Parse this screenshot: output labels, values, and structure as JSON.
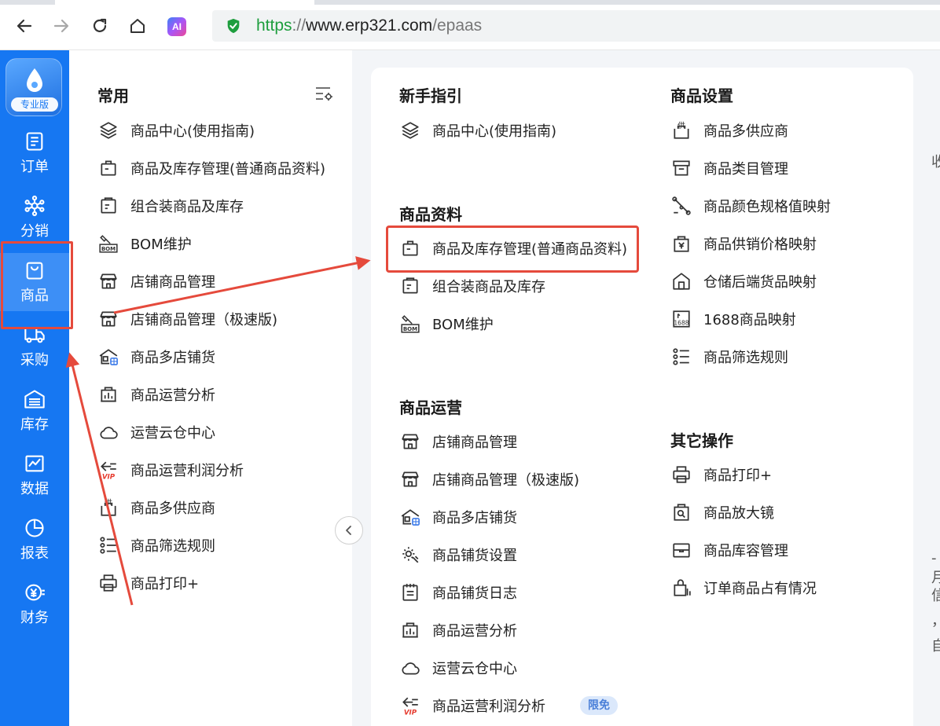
{
  "browser": {
    "url_scheme": "https",
    "url_sep": "://",
    "url_host": "www.erp321.com",
    "url_path": "/epaas",
    "ai_label": "AI"
  },
  "sidebar": {
    "logo_label": "专业版",
    "items": [
      {
        "label": "订单",
        "icon": "order-list-icon"
      },
      {
        "label": "分销",
        "icon": "distribution-network-icon"
      },
      {
        "label": "商品",
        "icon": "shopping-bag-icon"
      },
      {
        "label": "采购",
        "icon": "delivery-truck-icon"
      },
      {
        "label": "库存",
        "icon": "warehouse-icon"
      },
      {
        "label": "数据",
        "icon": "line-chart-icon"
      },
      {
        "label": "报表",
        "icon": "pie-chart-icon"
      },
      {
        "label": "财务",
        "icon": "yuan-coin-icon"
      }
    ]
  },
  "favorites": {
    "title": "常用",
    "items": [
      "商品中心(使用指南)",
      "商品及库存管理(普通商品资料)",
      "组合装商品及库存",
      "BOM维护",
      "店铺商品管理",
      "店铺商品管理（极速版)",
      "商品多店铺货",
      "商品运营分析",
      "运营云仓中心",
      "商品运营利润分析",
      "商品多供应商",
      "商品筛选规则",
      "商品打印+"
    ]
  },
  "menu": {
    "guide": {
      "title": "新手指引",
      "items": [
        "商品中心(使用指南)"
      ]
    },
    "data": {
      "title": "商品资料",
      "items": [
        "商品及库存管理(普通商品资料)",
        "组合装商品及库存",
        "BOM维护"
      ]
    },
    "ops": {
      "title": "商品运营",
      "items": [
        "店铺商品管理",
        "店铺商品管理（极速版)",
        "商品多店铺货",
        "商品铺货设置",
        "商品铺货日志",
        "商品运营分析",
        "运营云仓中心",
        "商品运营利润分析"
      ],
      "badge": "限免"
    },
    "settings": {
      "title": "商品设置",
      "items": [
        "商品多供应商",
        "商品类目管理",
        "商品颜色规格值映射",
        "商品供销价格映射",
        "仓储后端货品映射",
        "1688商品映射",
        "商品筛选规则"
      ]
    },
    "other": {
      "title": "其它操作",
      "items": [
        "商品打印+",
        "商品放大镜",
        "商品库容管理",
        "订单商品占有情况"
      ]
    }
  },
  "colors": {
    "sidebar_blue": "#1677f2",
    "highlight_red": "#e54a3c",
    "url_green": "#1e9e3e"
  },
  "peek_text": [
    "收",
    "-月",
    "信",
    "，",
    "自"
  ]
}
